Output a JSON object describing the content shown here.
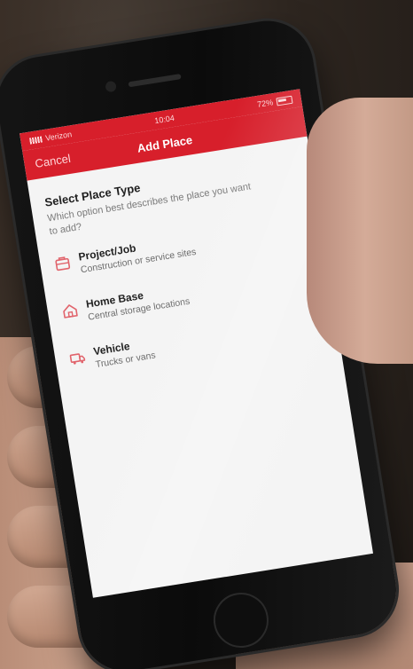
{
  "status_bar": {
    "carrier": "Verizon",
    "time": "10:04",
    "battery": "72%"
  },
  "nav": {
    "cancel_label": "Cancel",
    "title": "Add Place"
  },
  "content": {
    "title": "Select Place Type",
    "subtitle": "Which option best describes the place you want to add?",
    "options": [
      {
        "name": "Project/Job",
        "description": "Construction or service sites",
        "icon": "briefcase-icon"
      },
      {
        "name": "Home Base",
        "description": "Central storage locations",
        "icon": "home-icon"
      },
      {
        "name": "Vehicle",
        "description": "Trucks or vans",
        "icon": "truck-icon"
      }
    ]
  },
  "colors": {
    "accent": "#d71f2b",
    "icon": "#e1646c",
    "background": "#f4f4f4"
  }
}
